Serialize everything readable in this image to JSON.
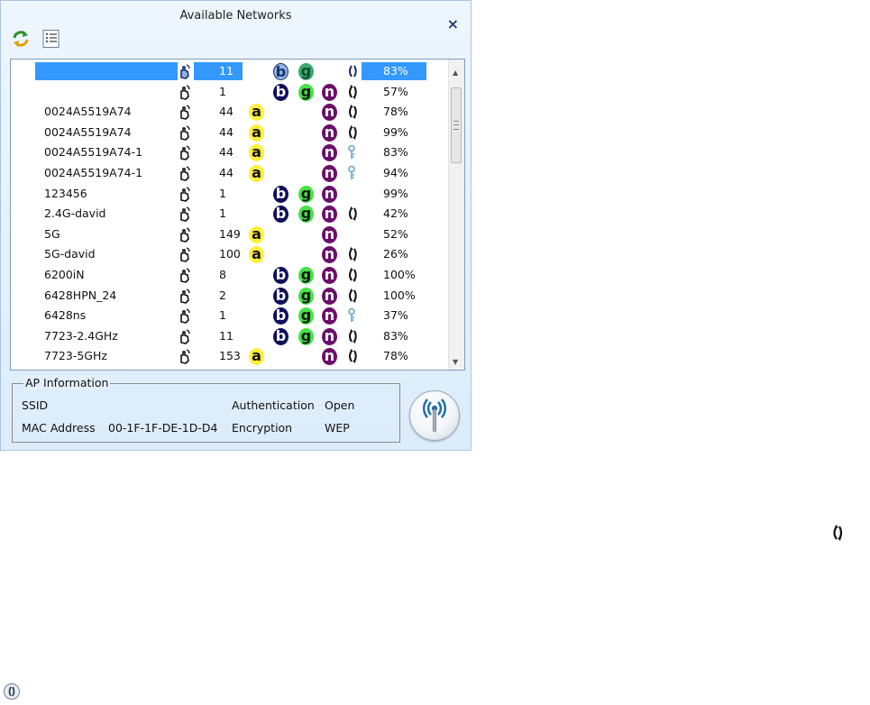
{
  "window": {
    "title": "Available Networks",
    "close_symbol": "×"
  },
  "toolbar": {
    "refresh_icon": "refresh-icon",
    "list_icon": "list-view-icon"
  },
  "columns_badges": {
    "a": "a",
    "b": "b",
    "g": "g",
    "n": "n"
  },
  "networks": [
    {
      "ssid": "",
      "channel": "11",
      "a": false,
      "b": true,
      "g": true,
      "n": false,
      "enc": "wps",
      "signal": "83%",
      "selected": true
    },
    {
      "ssid": "",
      "channel": "1",
      "a": false,
      "b": true,
      "g": true,
      "n": true,
      "enc": "wps",
      "signal": "57%"
    },
    {
      "ssid": "0024A5519A74",
      "channel": "44",
      "a": true,
      "b": false,
      "g": false,
      "n": true,
      "enc": "wps",
      "signal": "78%"
    },
    {
      "ssid": "0024A5519A74",
      "channel": "44",
      "a": true,
      "b": false,
      "g": false,
      "n": true,
      "enc": "wps",
      "signal": "99%"
    },
    {
      "ssid": "0024A5519A74-1",
      "channel": "44",
      "a": true,
      "b": false,
      "g": false,
      "n": true,
      "enc": "key",
      "signal": "83%"
    },
    {
      "ssid": "0024A5519A74-1",
      "channel": "44",
      "a": true,
      "b": false,
      "g": false,
      "n": true,
      "enc": "key",
      "signal": "94%"
    },
    {
      "ssid": "123456",
      "channel": "1",
      "a": false,
      "b": true,
      "g": true,
      "n": true,
      "enc": "none",
      "signal": "99%"
    },
    {
      "ssid": "2.4G-david",
      "channel": "1",
      "a": false,
      "b": true,
      "g": true,
      "n": true,
      "enc": "wps",
      "signal": "42%"
    },
    {
      "ssid": "5G",
      "channel": "149",
      "a": true,
      "b": false,
      "g": false,
      "n": true,
      "enc": "none",
      "signal": "52%"
    },
    {
      "ssid": "5G-david",
      "channel": "100",
      "a": true,
      "b": false,
      "g": false,
      "n": true,
      "enc": "wps",
      "signal": "26%"
    },
    {
      "ssid": "6200iN",
      "channel": "8",
      "a": false,
      "b": true,
      "g": true,
      "n": true,
      "enc": "wps",
      "signal": "100%"
    },
    {
      "ssid": "6428HPN_24",
      "channel": "2",
      "a": false,
      "b": true,
      "g": true,
      "n": true,
      "enc": "wps",
      "signal": "100%"
    },
    {
      "ssid": "6428ns",
      "channel": "1",
      "a": false,
      "b": true,
      "g": true,
      "n": true,
      "enc": "key",
      "signal": "37%"
    },
    {
      "ssid": "7723-2.4GHz",
      "channel": "11",
      "a": false,
      "b": true,
      "g": true,
      "n": true,
      "enc": "wps",
      "signal": "83%"
    },
    {
      "ssid": "7723-5GHz",
      "channel": "153",
      "a": true,
      "b": false,
      "g": false,
      "n": true,
      "enc": "wps",
      "signal": "78%"
    }
  ],
  "ap_info": {
    "legend": "AP Information",
    "ssid_label": "SSID",
    "ssid_value": "",
    "mac_label": "MAC Address",
    "mac_value": "00-1F-1F-DE-1D-D4",
    "auth_label": "Authentication",
    "auth_value": "Open",
    "enc_label": "Encryption",
    "enc_value": "WEP"
  },
  "connect_button_icon": "antenna-icon",
  "colors": {
    "selection": "#3399ff",
    "badge_a": "#ffef3a",
    "badge_b": "#10105a",
    "badge_g": "#45e245",
    "badge_n": "#6a0f6a",
    "key_icon": "#6aa9c8"
  }
}
